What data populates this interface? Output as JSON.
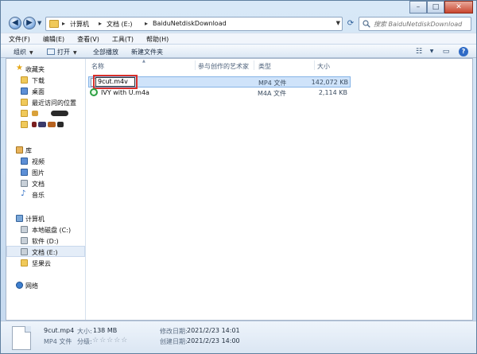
{
  "addressbar": {
    "crumbs": [
      "计算机",
      "文档 (E:)",
      "BaiduNetdiskDownload"
    ],
    "separator": "▸"
  },
  "search": {
    "placeholder": "搜索 BaiduNetdiskDownload"
  },
  "window_controls": {
    "minimize": "–",
    "maximize": "□",
    "close": "✕"
  },
  "menubar": [
    "文件(F)",
    "编辑(E)",
    "查看(V)",
    "工具(T)",
    "帮助(H)"
  ],
  "toolbar": {
    "organize": "组织",
    "open": "打开",
    "play_all": "全部播放",
    "new_folder": "新建文件夹"
  },
  "navpane": {
    "favorites": "收藏夹",
    "downloads": "下载",
    "desktop": "桌面",
    "recent": "最近访问的位置",
    "libraries": "库",
    "videos": "视频",
    "pictures": "图片",
    "documents": "文档",
    "music": "音乐",
    "computer": "计算机",
    "drive_c": "本地磁盘 (C:)",
    "drive_d": "软件 (D:)",
    "drive_e": "文档 (E:)",
    "nutstore": "坚果云",
    "network": "网络"
  },
  "columns": {
    "name": "名称",
    "artist": "参与创作的艺术家",
    "type": "类型",
    "size": "大小"
  },
  "files": [
    {
      "name": "9cut.m4v",
      "type": "MP4 文件",
      "size": "142,072 KB",
      "selected": true,
      "renaming": true
    },
    {
      "name": "IVY with U.m4a",
      "type": "M4A 文件",
      "size": "2,114 KB",
      "selected": false,
      "renaming": false
    }
  ],
  "details": {
    "filename": "9cut.mp4",
    "size_label": "大小:",
    "size_value": "138 MB",
    "type_value": "MP4 文件",
    "rating_label": "分级:",
    "rating_stars": "☆☆☆☆☆",
    "modified_label": "修改日期:",
    "modified_value": "2021/2/23 14:01",
    "created_label": "创建日期:",
    "created_value": "2021/2/23 14:00"
  },
  "colors": {
    "selection": "#cfe3fa",
    "highlight_box": "#d8302a"
  }
}
